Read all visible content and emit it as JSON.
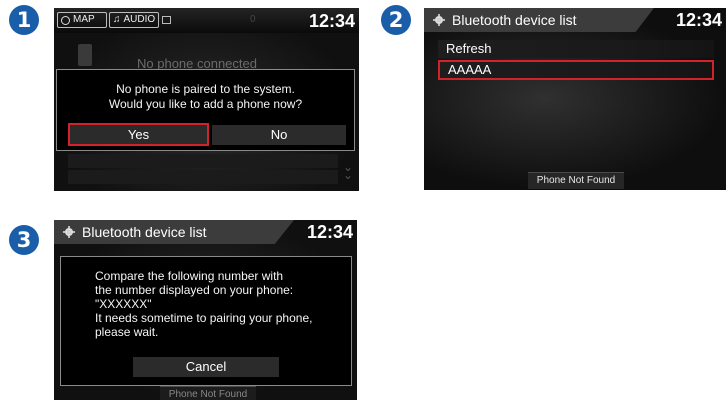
{
  "steps": [
    "1",
    "2",
    "3"
  ],
  "screen1": {
    "map_label": "MAP",
    "audio_label": "AUDIO",
    "clock": "12:34",
    "background_text": "No phone connected",
    "dialog_line1": "No phone is paired to the system.",
    "dialog_line2": "Would you like to add a phone now?",
    "yes_label": "Yes",
    "no_label": "No"
  },
  "screen2": {
    "title": "Bluetooth device list",
    "clock": "12:34",
    "items": [
      "Refresh",
      "AAAAA"
    ],
    "footer_button": "Phone Not Found"
  },
  "screen3": {
    "title": "Bluetooth device list",
    "clock": "12:34",
    "dialog_lines": [
      "Compare the following number with",
      "the number displayed on your phone:",
      "\"XXXXXX\"",
      "It needs sometime to pairing your phone,",
      "please wait."
    ],
    "cancel_label": "Cancel",
    "footer_button": "Phone Not Found"
  },
  "colors": {
    "step_badge": "#1a5da8",
    "highlight": "#d3222a",
    "screen_bg": "#0c0c0c"
  }
}
